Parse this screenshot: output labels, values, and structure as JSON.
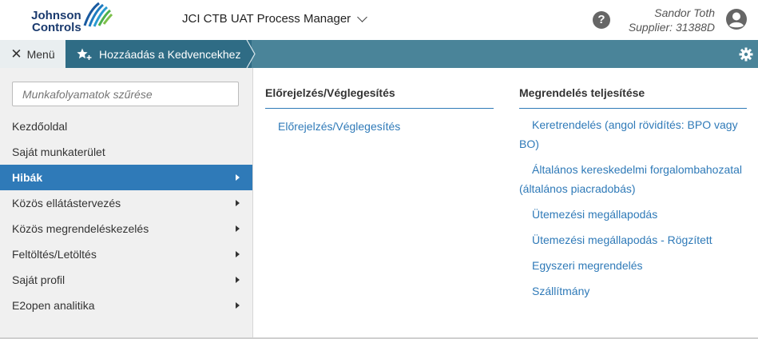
{
  "header": {
    "logo_line1": "Johnson",
    "logo_line2": "Controls",
    "app_title": "JCI CTB UAT Process Manager",
    "help_label": "?",
    "user_name": "Sandor Toth",
    "user_role": "Supplier: 31388D"
  },
  "toolbar": {
    "menu_label": "Menü",
    "close_glyph": "✕",
    "favorites_label": "Hozzáadás a Kedvencekhez"
  },
  "sidebar": {
    "filter_placeholder": "Munkafolyamatok szűrése",
    "items": [
      {
        "label": "Kezdőoldal",
        "has_submenu": false,
        "active": false
      },
      {
        "label": "Saját munkaterület",
        "has_submenu": false,
        "active": false
      },
      {
        "label": "Hibák",
        "has_submenu": true,
        "active": true
      },
      {
        "label": "Közös ellátástervezés",
        "has_submenu": true,
        "active": false
      },
      {
        "label": "Közös megrendeléskezelés",
        "has_submenu": true,
        "active": false
      },
      {
        "label": "Feltöltés/Letöltés",
        "has_submenu": true,
        "active": false
      },
      {
        "label": "Saját profil",
        "has_submenu": true,
        "active": false
      },
      {
        "label": "E2open analitika",
        "has_submenu": true,
        "active": false
      }
    ]
  },
  "content": {
    "col1": {
      "title": "Előrejelzés/Véglegesítés",
      "links": [
        "Előrejelzés/Véglegesítés"
      ]
    },
    "col2": {
      "title": "Megrendelés teljesítése",
      "links": [
        "Keretrendelés (angol rövidítés: BPO vagy BO)",
        "Általános kereskedelmi forgalombahozatal (általános piacradobás)",
        "Ütemezési megállapodás",
        "Ütemezési megállapodás - Rögzített",
        "Egyszeri megrendelés",
        "Szállítmány"
      ]
    }
  },
  "colors": {
    "toolbar_bg": "#4a8499",
    "favorites_bg": "#2f6c85",
    "active_item_bg": "#2f7ab8",
    "link": "#2f7ab8",
    "logo_text": "#1a3a6e"
  }
}
